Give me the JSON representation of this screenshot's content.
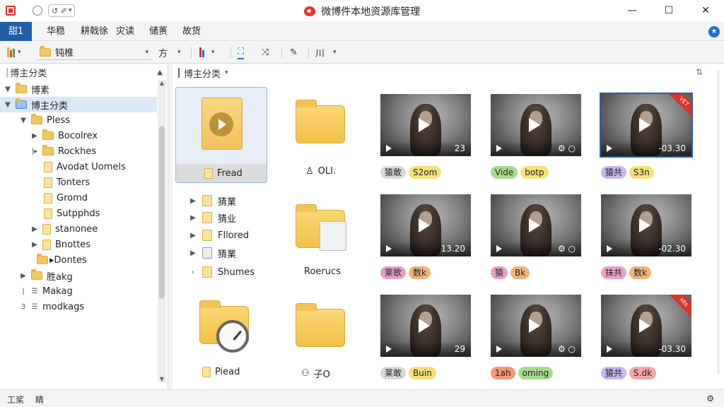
{
  "window": {
    "title": "微博件本地资源库管理",
    "quick_access": "↺ ✐",
    "minimize": "—",
    "maximize": "☐",
    "close": "✕"
  },
  "menu": {
    "items": [
      "甜1",
      "华稳",
      "耕戟徐",
      "灾读",
      "储蒉",
      "故货"
    ],
    "help": "★"
  },
  "toolbar": {
    "combo_value": "钝椎",
    "sort_label": "方",
    "tool_a": "⛶",
    "tool_b": "✎",
    "view_label": "川"
  },
  "left_panel": {
    "header": "博主分类",
    "tree": [
      {
        "label": "博素"
      },
      {
        "label": "博主分类"
      },
      {
        "label": "Pless"
      },
      {
        "label": "Bocolrex"
      },
      {
        "label": "Rockhes"
      },
      {
        "label": "Avodat Uomels"
      },
      {
        "label": "Tonters"
      },
      {
        "label": "Gromd"
      },
      {
        "label": "Sutpphds"
      },
      {
        "label": "stanonee"
      },
      {
        "label": "Bnottes"
      },
      {
        "label": "Dontes"
      },
      {
        "label": "胜akg"
      },
      {
        "label": "Makag"
      },
      {
        "label": "modkags"
      }
    ]
  },
  "right_panel": {
    "header": "博主分类",
    "items": {
      "fread": "Fread",
      "oli": "OLI.",
      "roerucs": "Roerucs",
      "piad": "Piead",
      "zo": "子O"
    },
    "sub_tree": [
      "猜業",
      "猜业",
      "Fllored",
      "猜業",
      "Shumes"
    ],
    "videos": [
      {
        "time": "23",
        "tags": [
          {
            "label": "猿敢",
            "color": "#d9d9d9"
          },
          {
            "label": "S2om",
            "color": "#f7e07a"
          }
        ],
        "corner": ""
      },
      {
        "time": "",
        "tags": [
          {
            "label": "Vide",
            "color": "#a6dc8b"
          },
          {
            "label": "botp",
            "color": "#f7e07a"
          }
        ],
        "corner": ""
      },
      {
        "time": "-03.30",
        "tags": [
          {
            "label": "猿共",
            "color": "#c8b6f0"
          },
          {
            "label": "S3n",
            "color": "#f7e07a"
          }
        ],
        "corner": "VET"
      },
      {
        "time": "13.20",
        "tags": [
          {
            "label": "莱歌",
            "color": "#e8a0c9"
          },
          {
            "label": "数k",
            "color": "#f4b37a"
          }
        ],
        "corner": ""
      },
      {
        "time": "",
        "tags": [
          {
            "label": "猿",
            "color": "#e8a0c9"
          },
          {
            "label": "Bk",
            "color": "#f4b37a"
          }
        ],
        "corner": ""
      },
      {
        "time": "-02.30",
        "tags": [
          {
            "label": "抹共",
            "color": "#f0a3c8"
          },
          {
            "label": "数k",
            "color": "#f4b37a"
          }
        ],
        "corner": ""
      },
      {
        "time": "29",
        "tags": [
          {
            "label": "莱敢",
            "color": "#d9d9d9"
          },
          {
            "label": "Buin",
            "color": "#f7e07a"
          }
        ],
        "corner": ""
      },
      {
        "time": "",
        "tags": [
          {
            "label": "1ah",
            "color": "#f29a7a"
          },
          {
            "label": "oming",
            "color": "#a6dc8b"
          }
        ],
        "corner": ""
      },
      {
        "time": "-03.30",
        "tags": [
          {
            "label": "猿共",
            "color": "#c8b6f0"
          },
          {
            "label": "S.dk",
            "color": "#f4a6a6"
          }
        ],
        "corner": "Hts"
      }
    ]
  },
  "status": {
    "left": "工桨",
    "middle": "睛"
  }
}
